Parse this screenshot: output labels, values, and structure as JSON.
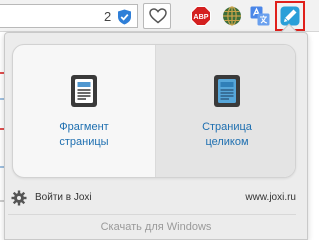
{
  "toolbar": {
    "url_badge_count": "2",
    "icons": [
      "shield-check-icon",
      "heart-icon",
      "adblock-plus-icon",
      "globe-icon",
      "translate-icon",
      "joxi-icon"
    ],
    "abp_text": "ABP",
    "highlight_color": "#e0201b"
  },
  "popup": {
    "options": [
      {
        "label_line1": "Фрагмент",
        "label_line2": "страницы",
        "icon": "document-icon"
      },
      {
        "label_line1": "Страница",
        "label_line2": "целиком",
        "icon": "document-icon"
      }
    ],
    "login_label": "Войти в Joxi",
    "site_label": "www.joxi.ru",
    "download_label": "Скачать для Windows",
    "accent_color": "#1e6fb0"
  }
}
